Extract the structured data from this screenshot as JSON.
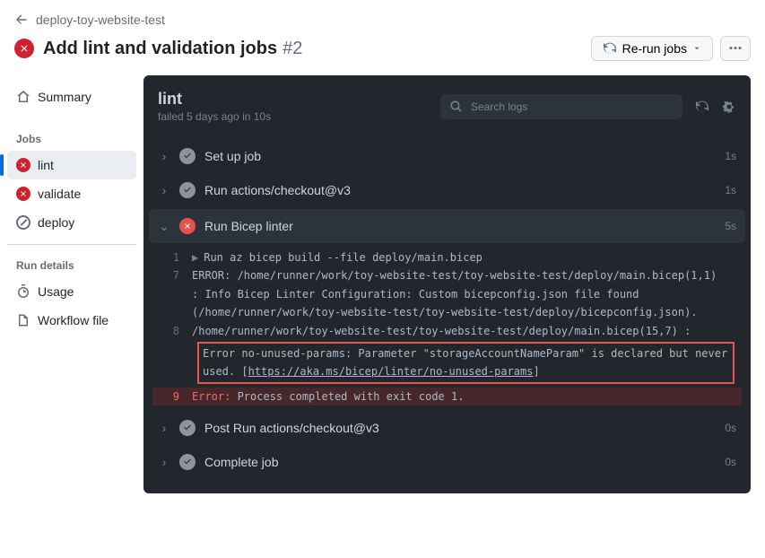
{
  "breadcrumb": {
    "repo": "deploy-toy-website-test"
  },
  "title": {
    "name": "Add lint and validation jobs",
    "number": "#2"
  },
  "header_actions": {
    "rerun": "Re-run jobs"
  },
  "sidebar": {
    "summary": "Summary",
    "jobs_label": "Jobs",
    "jobs": [
      {
        "label": "lint",
        "status": "fail",
        "active": true
      },
      {
        "label": "validate",
        "status": "fail",
        "active": false
      },
      {
        "label": "deploy",
        "status": "skipped",
        "active": false
      }
    ],
    "run_details_label": "Run details",
    "usage": "Usage",
    "workflow_file": "Workflow file"
  },
  "job": {
    "name": "lint",
    "meta": "failed 5 days ago in 10s",
    "search_placeholder": "Search logs"
  },
  "steps": [
    {
      "name": "Set up job",
      "status": "ok",
      "dur": "1s",
      "expanded": false
    },
    {
      "name": "Run actions/checkout@v3",
      "status": "ok",
      "dur": "1s",
      "expanded": false
    },
    {
      "name": "Run Bicep linter",
      "status": "fail",
      "dur": "5s",
      "expanded": true
    },
    {
      "name": "Post Run actions/checkout@v3",
      "status": "ok",
      "dur": "0s",
      "expanded": false
    },
    {
      "name": "Complete job",
      "status": "ok",
      "dur": "0s",
      "expanded": false
    }
  ],
  "log": {
    "l1": "Run az bicep build --file deploy/main.bicep",
    "l7a": "ERROR: /home/runner/work/toy-website-test/toy-website-test/deploy/main.bicep(1,1) ",
    "l7b": ": Info Bicep Linter Configuration: Custom bicepconfig.json file found ",
    "l7c": "(/home/runner/work/toy-website-test/toy-website-test/deploy/bicepconfig.json).",
    "l8": "/home/runner/work/toy-website-test/toy-website-test/deploy/main.bicep(15,7) : ",
    "hl_pre": "Error no-unused-params: Parameter \"storageAccountNameParam\" is declared but never used. [",
    "hl_link": "https://aka.ms/bicep/linter/no-unused-params",
    "hl_post": "]",
    "l9a": "Error:",
    "l9b": " Process completed with exit code 1."
  }
}
